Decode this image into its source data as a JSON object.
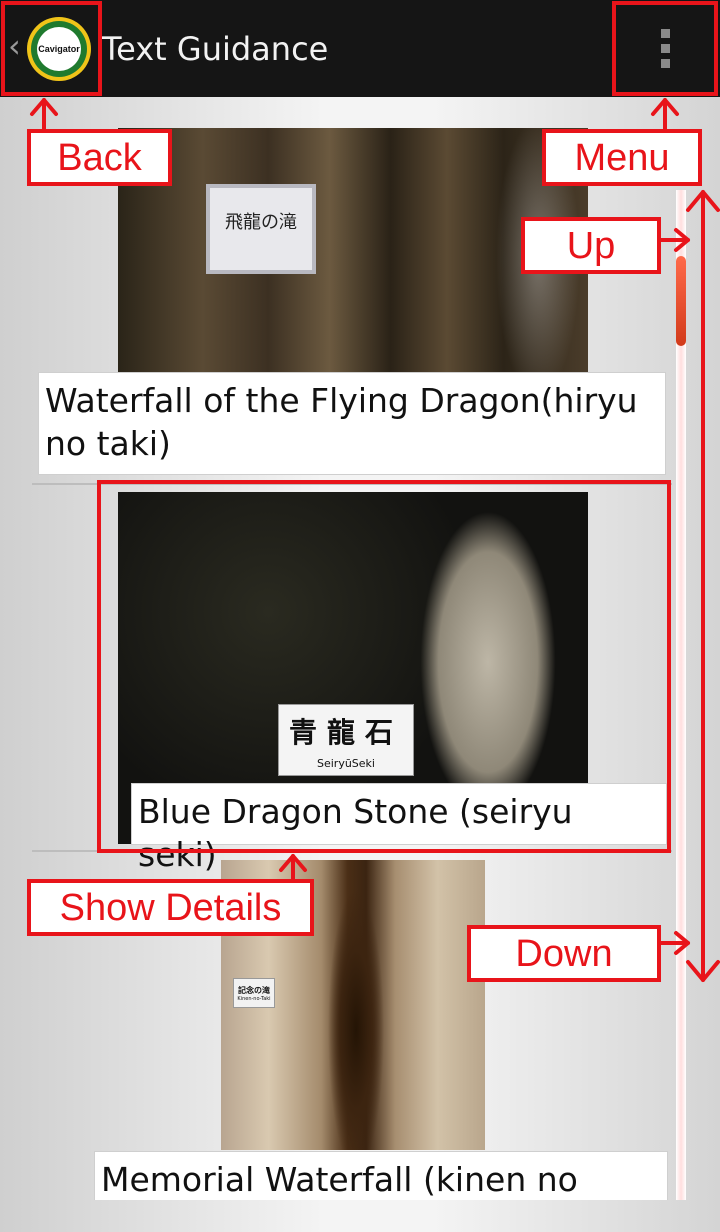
{
  "actionbar": {
    "title": "Text Guidance",
    "logo_text": "Cavigator",
    "back_glyph": "‹"
  },
  "items": [
    {
      "label": "Waterfall of the Flying Dragon(hiryu no taki)",
      "sign_text": "飛龍の滝"
    },
    {
      "label": "Blue Dragon Stone (seiryu seki)",
      "sign_text": "青龍石",
      "sign_subtext": "SeiryūSeki"
    },
    {
      "label": "Memorial Waterfall (kinen no taki)",
      "sign_text": "記念の滝",
      "sign_subtext": "Kinen-no-Taki"
    }
  ],
  "annotations": {
    "back": "Back",
    "menu": "Menu",
    "up": "Up",
    "show_details": "Show Details",
    "down": "Down"
  },
  "colors": {
    "annotation": "#e8141a",
    "actionbar": "#151515",
    "scroll_thumb": "#d23a1a"
  },
  "icons": [
    "back-chevron-icon",
    "app-logo-icon",
    "overflow-menu-icon"
  ]
}
